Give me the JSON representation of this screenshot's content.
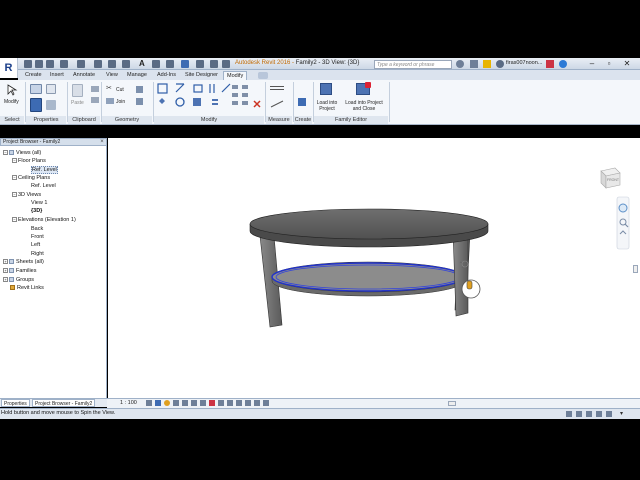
{
  "app": {
    "logo_letter": "R",
    "title_brand": "Autodesk Revit 2016 -",
    "title_doc": "Family2 - 3D View: {3D}",
    "search_placeholder": "Type a keyword or phrase",
    "user": "firas007noon...",
    "accent": "#1b3f8a"
  },
  "tabs": [
    "Create",
    "Insert",
    "Annotate",
    "View",
    "Manage",
    "Add-Ins",
    "Site Designer",
    "Modify"
  ],
  "active_tab": "Modify",
  "ribbon": {
    "select_label": "Modify",
    "clipboard": {
      "paste": "Paste",
      "cut": "Cut",
      "join": "Join"
    },
    "load_into_project": "Load into Project",
    "load_into_project_close": "Load into Project and Close",
    "panels": [
      "Select",
      "Properties",
      "Clipboard",
      "Geometry",
      "Modify",
      "Measure",
      "Create",
      "Family Editor"
    ]
  },
  "project_browser": {
    "title": "Project Browser - Family2",
    "close": "×",
    "tree": [
      {
        "label": "Views (all)",
        "toggle": "−"
      },
      {
        "label": "Floor Plans",
        "toggle": "−"
      },
      {
        "label": "Ref. Level",
        "selected": true
      },
      {
        "label": "Ceiling Plans",
        "toggle": "−"
      },
      {
        "label": "Ref. Level"
      },
      {
        "label": "3D Views",
        "toggle": "−"
      },
      {
        "label": "View 1"
      },
      {
        "label": "{3D}",
        "bold": true
      },
      {
        "label": "Elevations (Elevation 1)",
        "toggle": "−"
      },
      {
        "label": "Back"
      },
      {
        "label": "Front"
      },
      {
        "label": "Left"
      },
      {
        "label": "Right"
      },
      {
        "label": "Sheets (all)",
        "toggle": "+"
      },
      {
        "label": "Families",
        "toggle": "+"
      },
      {
        "label": "Groups",
        "toggle": "+"
      },
      {
        "label": "Revit Links"
      }
    ]
  },
  "bottom_tabs": [
    "Properties",
    "Project Browser - Family2"
  ],
  "view_control": {
    "scale": "1 : 100"
  },
  "viewcube_label": "FRONT",
  "status_text": "Hold button and move mouse to Spin the View."
}
